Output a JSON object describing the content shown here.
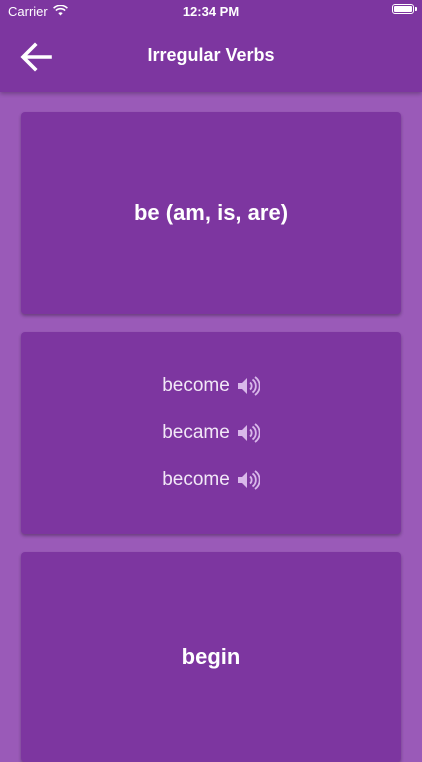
{
  "status": {
    "carrier": "Carrier",
    "time": "12:34 PM"
  },
  "nav": {
    "title": "Irregular Verbs",
    "back_icon": "arrow-left-icon"
  },
  "cards": [
    {
      "word": "be (am, is, are)"
    },
    {
      "forms": [
        "become",
        "became",
        "become"
      ],
      "icon": "speaker-icon"
    },
    {
      "word": "begin"
    }
  ],
  "colors": {
    "background": "#9a5ab8",
    "bar": "#7d36a0",
    "card": "#7d36a0",
    "text": "#ffffff"
  }
}
